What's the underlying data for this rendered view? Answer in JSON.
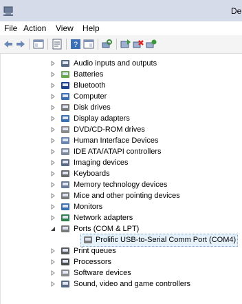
{
  "window": {
    "title": "De"
  },
  "menu": {
    "items": [
      "File",
      "Action",
      "View",
      "Help"
    ]
  },
  "toolbar": {
    "buttons": [
      "back-icon",
      "forward-icon",
      "show-hide-console-tree-icon",
      "properties-icon",
      "help-icon",
      "action-pane-icon",
      "scan-hardware-icon",
      "update-driver-icon",
      "uninstall-icon",
      "enable-device-icon"
    ]
  },
  "tree": {
    "items": [
      {
        "label": "Audio inputs and outputs",
        "expanded": false,
        "icon": "speaker-icon"
      },
      {
        "label": "Batteries",
        "expanded": false,
        "icon": "battery-icon"
      },
      {
        "label": "Bluetooth",
        "expanded": false,
        "icon": "bluetooth-icon"
      },
      {
        "label": "Computer",
        "expanded": false,
        "icon": "computer-icon"
      },
      {
        "label": "Disk drives",
        "expanded": false,
        "icon": "disk-drive-icon"
      },
      {
        "label": "Display adapters",
        "expanded": false,
        "icon": "display-adapter-icon"
      },
      {
        "label": "DVD/CD-ROM drives",
        "expanded": false,
        "icon": "dvd-drive-icon"
      },
      {
        "label": "Human Interface Devices",
        "expanded": false,
        "icon": "hid-icon"
      },
      {
        "label": "IDE ATA/ATAPI controllers",
        "expanded": false,
        "icon": "ide-controller-icon"
      },
      {
        "label": "Imaging devices",
        "expanded": false,
        "icon": "imaging-icon"
      },
      {
        "label": "Keyboards",
        "expanded": false,
        "icon": "keyboard-icon"
      },
      {
        "label": "Memory technology devices",
        "expanded": false,
        "icon": "memory-icon"
      },
      {
        "label": "Mice and other pointing devices",
        "expanded": false,
        "icon": "mouse-icon"
      },
      {
        "label": "Monitors",
        "expanded": false,
        "icon": "monitor-icon"
      },
      {
        "label": "Network adapters",
        "expanded": false,
        "icon": "network-adapter-icon"
      },
      {
        "label": "Ports (COM & LPT)",
        "expanded": true,
        "icon": "port-icon"
      },
      {
        "label": "Prolific USB-to-Serial Comm Port (COM4)",
        "child": true,
        "selected": true,
        "icon": "port-icon"
      },
      {
        "label": "Print queues",
        "expanded": false,
        "icon": "printer-icon"
      },
      {
        "label": "Processors",
        "expanded": false,
        "icon": "processor-icon"
      },
      {
        "label": "Software devices",
        "expanded": false,
        "icon": "software-device-icon"
      },
      {
        "label": "Sound, video and game controllers",
        "expanded": false,
        "icon": "sound-controller-icon"
      }
    ]
  }
}
